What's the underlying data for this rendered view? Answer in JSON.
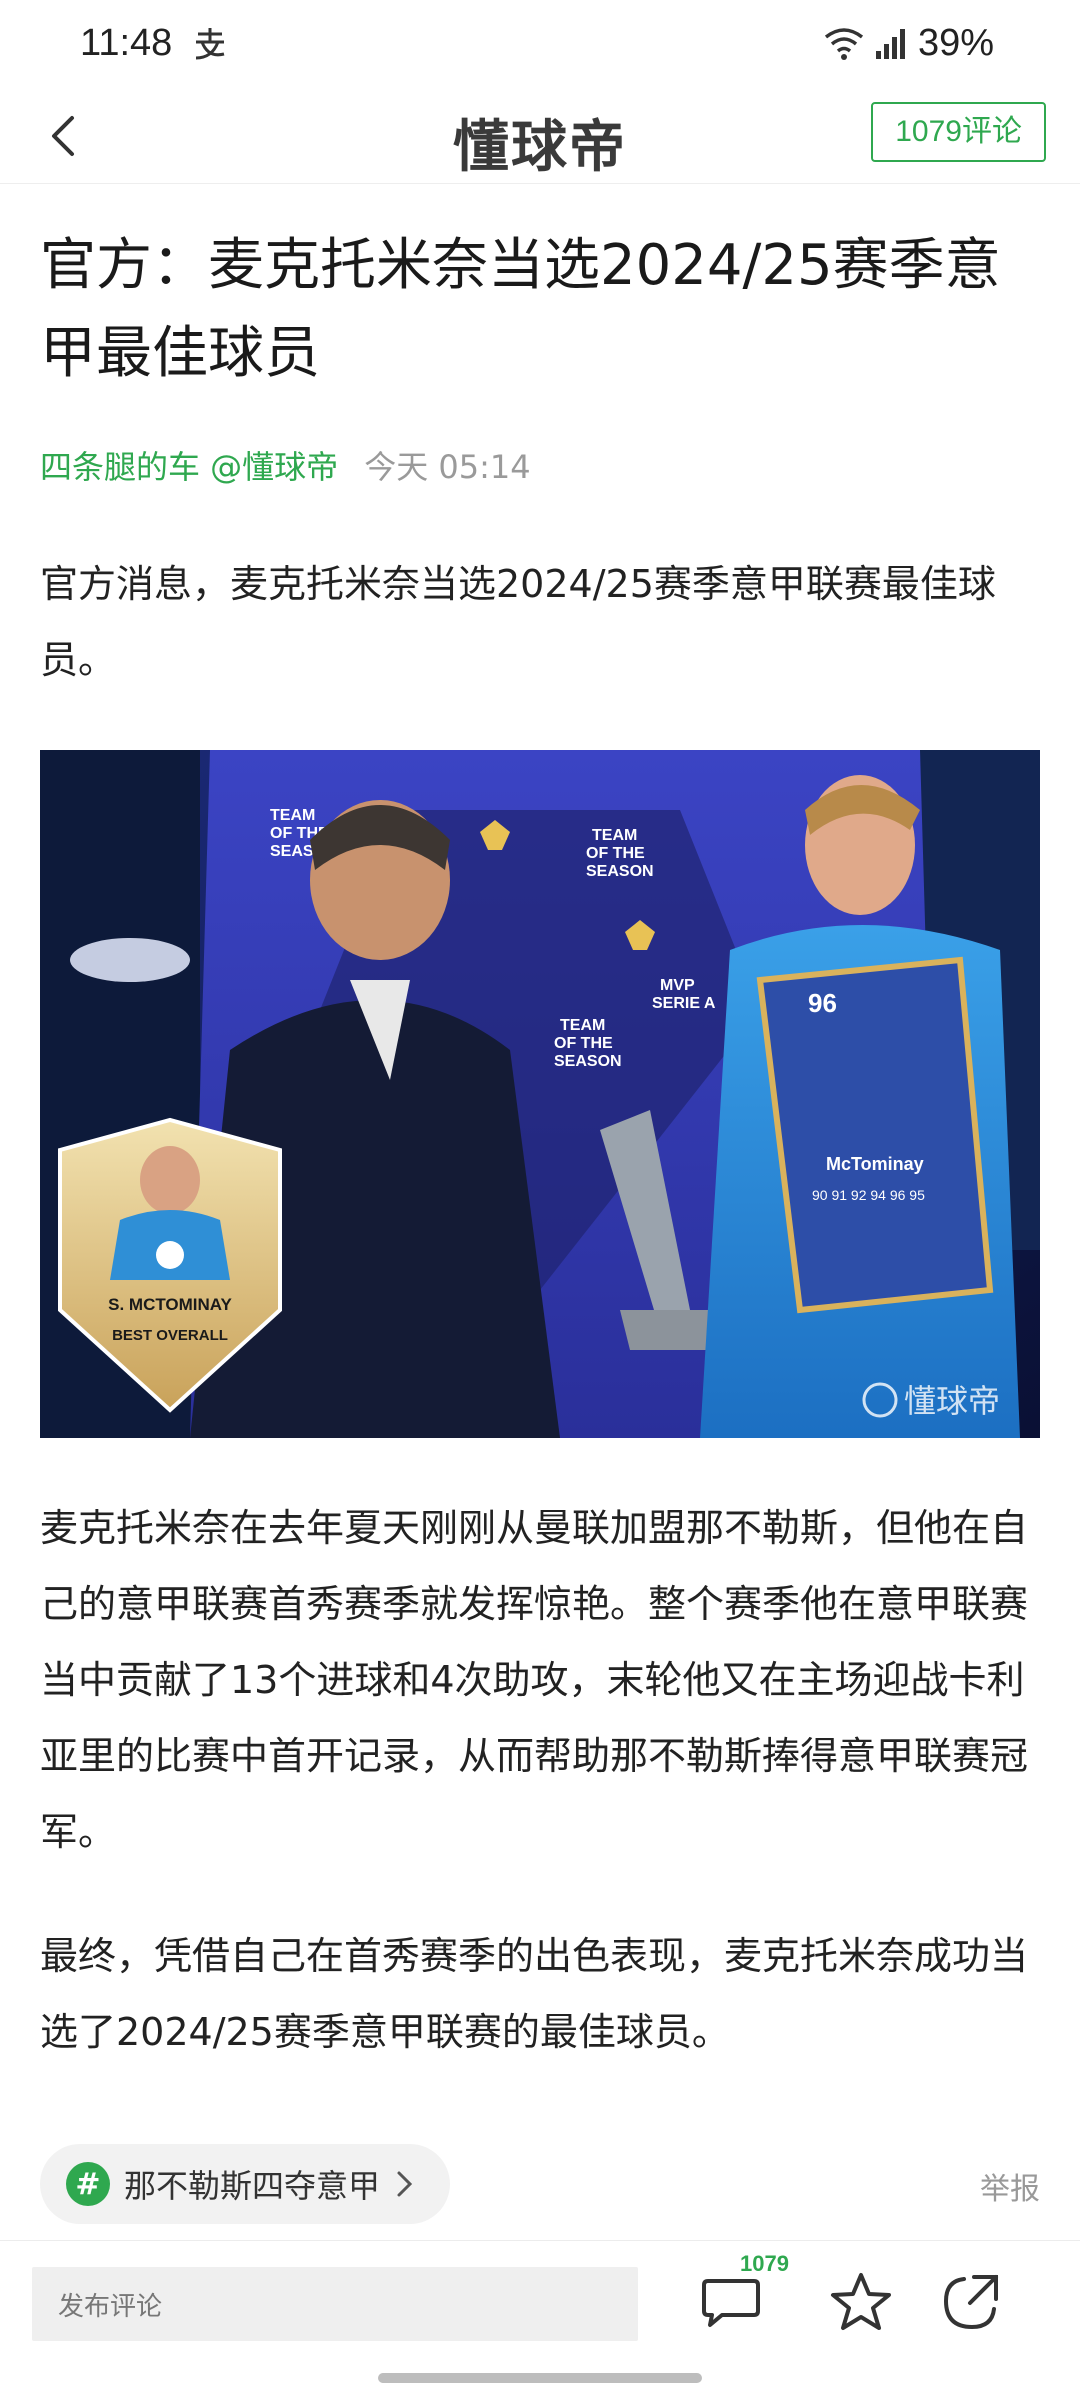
{
  "status_bar": {
    "time": "11:48",
    "battery": "39%"
  },
  "nav": {
    "logo": "懂球帝",
    "comment_button": "1079评论"
  },
  "article": {
    "title": "官方：麦克托米奈当选2024/25赛季意甲最佳球员",
    "author": "四条腿的车 @懂球帝",
    "time": "今天 05:14",
    "paragraphs": [
      "官方消息，麦克托米奈当选2024/25赛季意甲联赛最佳球员。",
      "麦克托米奈在去年夏天刚刚从曼联加盟那不勒斯，但他在自己的意甲联赛首秀赛季就发挥惊艳。整个赛季他在意甲联赛当中贡献了13个进球和4次助攻，末轮他又在主场迎战卡利亚里的比赛中首开记录，从而帮助那不勒斯捧得意甲联赛冠军。",
      "最终，凭借自己在首秀赛季的出色表现，麦克托米奈成功当选了2024/25赛季意甲联赛的最佳球员。"
    ],
    "image": {
      "card_name": "S. MCTOMINAY",
      "card_caption": "BEST OVERALL",
      "board_texts": [
        "TEAM OF THE SEASON",
        "MVP SERIE A"
      ],
      "fut_card_name": "McTominay",
      "fut_card_rating": "96",
      "fut_card_stats": "90 91 92 94 96 95",
      "watermark": "懂球帝"
    }
  },
  "topic": {
    "hash": "#",
    "label": "那不勒斯四夺意甲"
  },
  "report_label": "举报",
  "bottom_bar": {
    "comment_placeholder": "发布评论",
    "comment_count": "1079"
  },
  "colors": {
    "accent_green": "#2fa84f"
  }
}
